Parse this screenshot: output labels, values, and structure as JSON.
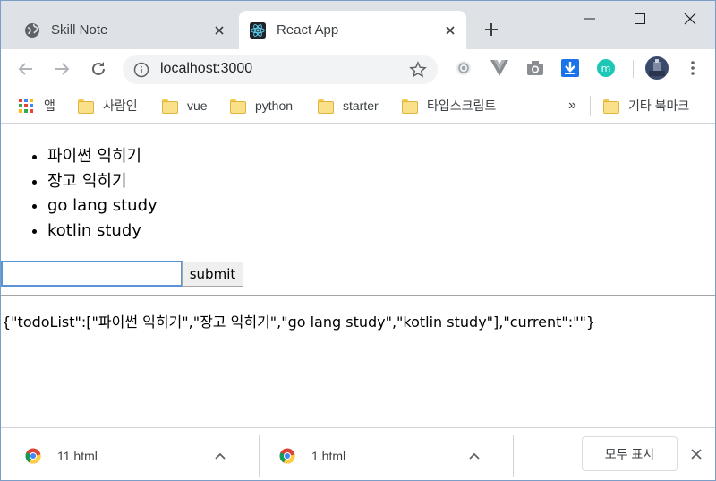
{
  "tabs": [
    {
      "title": "Skill Note",
      "active": false
    },
    {
      "title": "React App",
      "active": true
    }
  ],
  "address_bar": {
    "url": "localhost:3000"
  },
  "bookmarks": {
    "apps_label": "앱",
    "items": [
      "사람인",
      "vue",
      "python",
      "starter",
      "타입스크립트"
    ],
    "overflow": "»",
    "other": "기타 북마크"
  },
  "page": {
    "todo_items": [
      "파이썬 익히기",
      "장고 익히기",
      "go lang study",
      "kotlin study"
    ],
    "input_value": "",
    "submit_label": "submit",
    "state_json": "{\"todoList\":[\"파이썬 익히기\",\"장고 익히기\",\"go lang study\",\"kotlin study\"],\"current\":\"\"}"
  },
  "downloads": {
    "items": [
      {
        "filename": "11.html"
      },
      {
        "filename": "1.html"
      }
    ],
    "show_all_label": "모두 표시"
  },
  "colors": {
    "tabstrip_bg": "#dee1e6",
    "react_accent": "#61dafb",
    "input_focus": "#5b94d6"
  }
}
